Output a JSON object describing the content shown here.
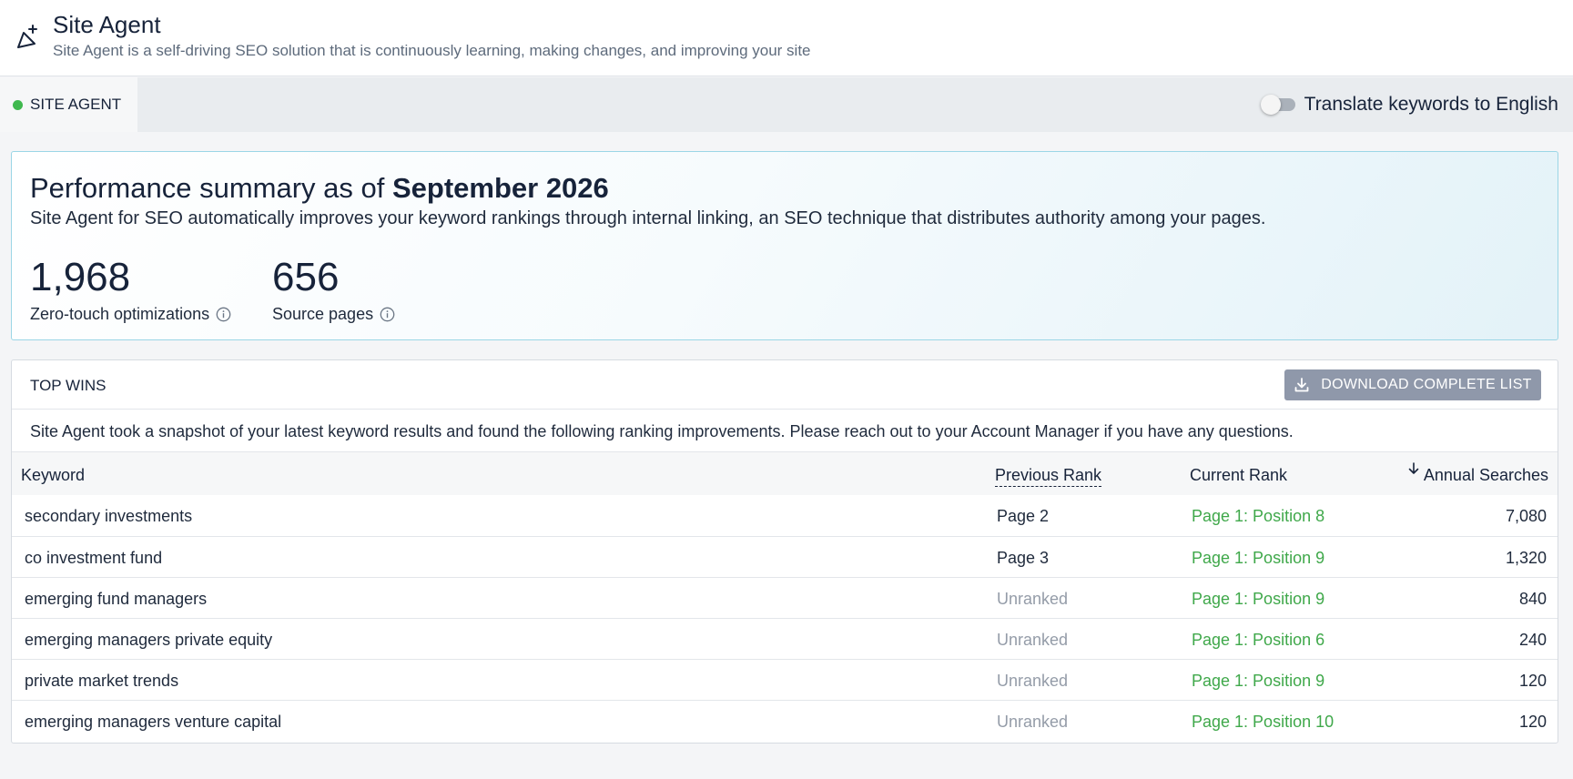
{
  "header": {
    "title": "Site Agent",
    "subtitle": "Site Agent is a self-driving SEO solution that is continuously learning, making changes, and improving your site",
    "icon": "sparkle-wand-icon"
  },
  "tabs": {
    "active_label": "SITE AGENT",
    "status_color": "#3fb84e"
  },
  "translate_toggle": {
    "label": "Translate keywords to English",
    "enabled": false
  },
  "performance": {
    "title_prefix": "Performance summary as of",
    "title_date": "September 2026",
    "description": "Site Agent for SEO automatically improves your keyword rankings through internal linking, an SEO technique that distributes authority among your pages.",
    "metrics": [
      {
        "value": "1,968",
        "label": "Zero-touch optimizations"
      },
      {
        "value": "656",
        "label": "Source pages"
      }
    ]
  },
  "top_wins": {
    "title": "TOP WINS",
    "download_label": "DOWNLOAD COMPLETE LIST",
    "description": "Site Agent took a snapshot of your latest keyword results and found the following ranking improvements. Please reach out to your Account Manager if you have any questions.",
    "columns": {
      "keyword": "Keyword",
      "previous_rank": "Previous Rank",
      "current_rank": "Current Rank",
      "annual_searches": "Annual Searches"
    },
    "rows": [
      {
        "keyword": "secondary investments",
        "previous": "Page 2",
        "current": "Page 1: Position 8",
        "searches": "7,080"
      },
      {
        "keyword": "co investment fund",
        "previous": "Page 3",
        "current": "Page 1: Position 9",
        "searches": "1,320"
      },
      {
        "keyword": "emerging fund managers",
        "previous": "Unranked",
        "current": "Page 1: Position 9",
        "searches": "840"
      },
      {
        "keyword": "emerging managers private equity",
        "previous": "Unranked",
        "current": "Page 1: Position 6",
        "searches": "240"
      },
      {
        "keyword": "private market trends",
        "previous": "Unranked",
        "current": "Page 1: Position 9",
        "searches": "120"
      },
      {
        "keyword": "emerging managers venture capital",
        "previous": "Unranked",
        "current": "Page 1: Position 10",
        "searches": "120"
      }
    ]
  },
  "colors": {
    "accent_green": "#3fa84a",
    "button_gray": "#8f98aa",
    "card_border": "#9bd6e6"
  }
}
